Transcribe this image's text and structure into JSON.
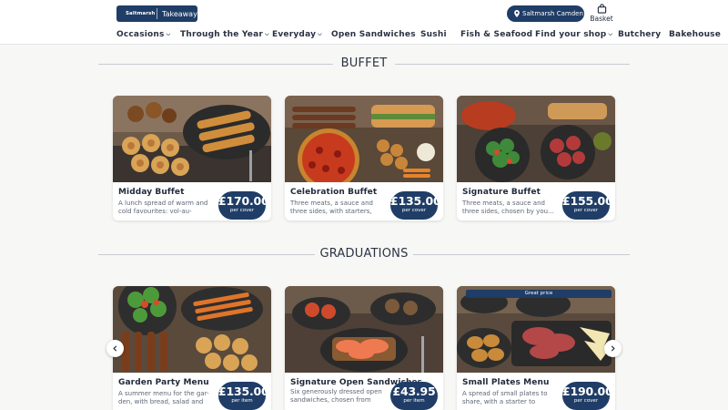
{
  "header": {
    "logo_brand": "Saltmarsh",
    "logo_sub": "Takeaway",
    "store_label": "Saltmarsh Camden",
    "basket_label": "Basket"
  },
  "nav": [
    {
      "label": "Occasions",
      "dropdown": true
    },
    {
      "label": "Through the Year",
      "dropdown": true
    },
    {
      "label": "Everyday",
      "dropdown": true
    },
    {
      "label": "Open Sandwiches",
      "dropdown": false
    },
    {
      "label": "Sushi",
      "dropdown": false
    },
    {
      "label": "Fish & Seafood",
      "dropdown": false
    },
    {
      "label": "Find your shop",
      "dropdown": true
    },
    {
      "label": "Butchery",
      "dropdown": false
    },
    {
      "label": "Bakehouse",
      "dropdown": false
    }
  ],
  "sections": [
    {
      "title": "BUFFET",
      "cards": [
        {
          "name": "Midday Buffet",
          "desc": "A lunch spread of warm and cold favourites: vol-au-vents...",
          "price": "£170.00",
          "per": "per cover"
        },
        {
          "name": "Celebration Buffet",
          "desc": "Three meats, a sauce and three sides, with starters, de...",
          "price": "£135.00",
          "per": "per cover"
        },
        {
          "name": "Signature Buffet",
          "desc": "Three meats, a sauce and three sides, chosen by you...",
          "price": "£155.00",
          "per": "per cover"
        }
      ]
    },
    {
      "title": "GRADUATIONS",
      "cards": [
        {
          "name": "Garden Party Menu",
          "desc": "A summer menu for the gar-den, with bread, salad and a...",
          "price": "£135.00",
          "per": "per item"
        },
        {
          "name": "Signature Open Sandwiches",
          "desc": "Six generously dressed open sandwiches, chosen from our...",
          "price": "£43.95",
          "per": "per item"
        },
        {
          "name": "Small Plates Menu",
          "desc": "A spread of small plates to share, with a starter to open...",
          "price": "£190.00",
          "per": "per cover",
          "tag": "Great price"
        }
      ]
    }
  ],
  "carousel": {
    "prev_icon": "chevron-left-icon",
    "next_icon": "chevron-right-icon"
  },
  "colors": {
    "brand": "#1f3d66",
    "background": "#f7f7f5"
  }
}
